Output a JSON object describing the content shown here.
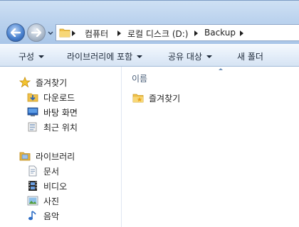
{
  "window": {
    "address_path": [
      "컴퓨터",
      "로컬 디스크 (D:)",
      "Backup"
    ]
  },
  "toolbar": {
    "organize_label": "구성",
    "include_in_library_label": "라이브러리에 포함",
    "share_with_label": "공유 대상",
    "new_folder_label": "새 폴더"
  },
  "navigation": {
    "favorites": {
      "label": "즐겨찾기",
      "items": [
        {
          "label": "다운로드",
          "icon": "downloads-folder-icon"
        },
        {
          "label": "바탕 화면",
          "icon": "desktop-icon"
        },
        {
          "label": "최근 위치",
          "icon": "recent-places-icon"
        }
      ]
    },
    "libraries": {
      "label": "라이브러리",
      "items": [
        {
          "label": "문서",
          "icon": "documents-icon"
        },
        {
          "label": "비디오",
          "icon": "videos-icon"
        },
        {
          "label": "사진",
          "icon": "pictures-icon"
        },
        {
          "label": "음악",
          "icon": "music-icon"
        }
      ]
    }
  },
  "content": {
    "column_header": "이름",
    "files": [
      {
        "name": "즐겨찾기",
        "icon": "favorites-folder-icon"
      }
    ]
  },
  "colors": {
    "chrome_top": "#cfe1f4",
    "chrome_bottom": "#a9c6e8",
    "toolbar": "#e5eef9",
    "folder_yellow": "#f3c84b",
    "accent_blue": "#2f67b5"
  }
}
